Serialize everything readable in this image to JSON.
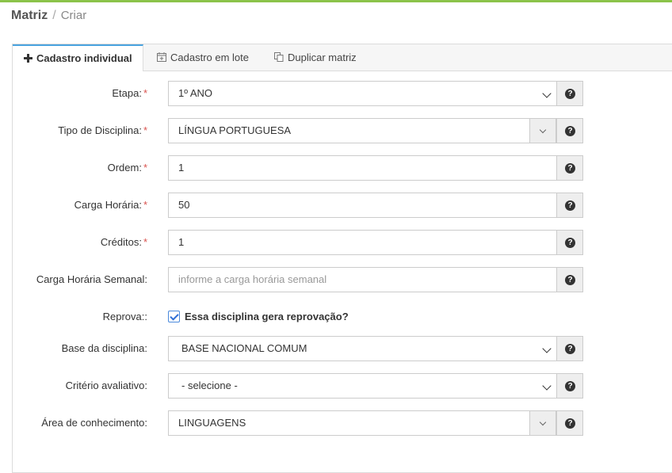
{
  "breadcrumb": {
    "section": "Matriz",
    "separator": "/",
    "current": "Criar"
  },
  "tabs": [
    {
      "label": "Cadastro individual",
      "icon": "plus-icon",
      "active": true
    },
    {
      "label": "Cadastro em lote",
      "icon": "calendar-icon",
      "active": false
    },
    {
      "label": "Duplicar matriz",
      "icon": "copy-icon",
      "active": false
    }
  ],
  "form": {
    "etapa": {
      "label": "Etapa:",
      "value": "1º ANO",
      "required": "*"
    },
    "tipo_disciplina": {
      "label": "Tipo de Disciplina:",
      "value": "LÍNGUA PORTUGUESA",
      "required": "*"
    },
    "ordem": {
      "label": "Ordem:",
      "value": "1",
      "required": "*"
    },
    "carga_horaria": {
      "label": "Carga Horária:",
      "value": "50",
      "required": "*"
    },
    "creditos": {
      "label": "Créditos:",
      "value": "1",
      "required": "*"
    },
    "carga_horaria_semanal": {
      "label": "Carga Horária Semanal:",
      "value": "",
      "placeholder": "informe a carga horária semanal"
    },
    "reprova": {
      "label": "Reprova::",
      "checkbox_label": "Essa disciplina gera reprovação?",
      "checked": true
    },
    "base_disciplina": {
      "label": "Base da disciplina:",
      "value": "BASE NACIONAL COMUM"
    },
    "criterio_avaliativo": {
      "label": "Critério avaliativo:",
      "value": "- selecione -"
    },
    "area_conhecimento": {
      "label": "Área de conhecimento:",
      "value": "LINGUAGENS"
    }
  },
  "colors": {
    "accent": "#8bc34a",
    "tab_active_border": "#4aa3df",
    "required": "#d9534f",
    "checkbox": "#2f6fd6"
  }
}
